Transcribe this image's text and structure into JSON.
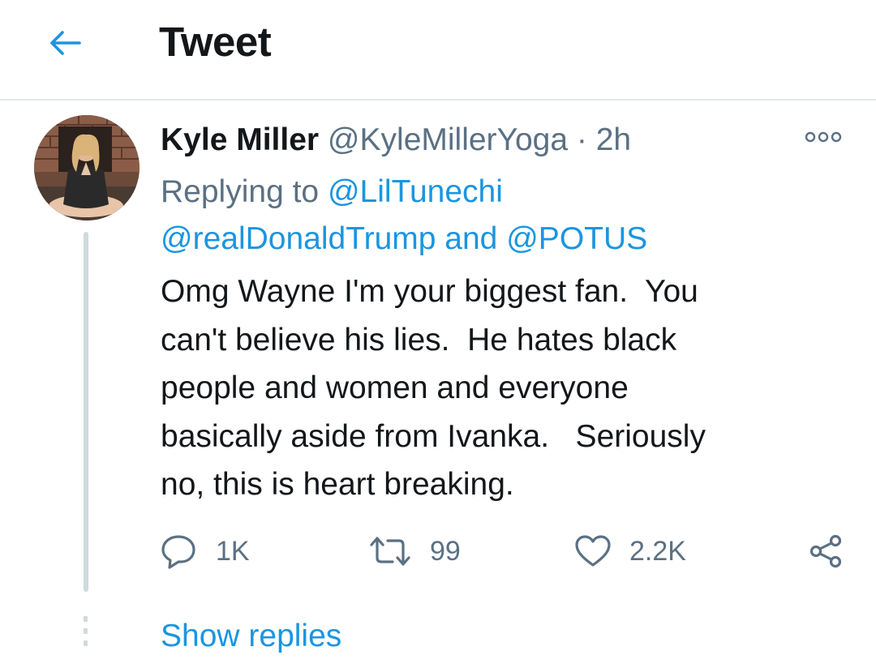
{
  "header": {
    "title": "Tweet",
    "back_icon": "arrow-left-icon"
  },
  "tweet": {
    "author": {
      "display_name": "Kyle Miller",
      "handle": "@KyleMillerYoga",
      "separator": "·",
      "time": "2h"
    },
    "replying_to": {
      "prefix": "Replying to",
      "mention_1": "@LilTunechi",
      "mention_2": "@realDonaldTrump",
      "conjunction": "and",
      "mention_3": "@POTUS"
    },
    "text": "Omg Wayne I'm your biggest fan.  You\ncan't believe his lies.  He hates black\npeople and women and everyone\nbasically aside from Ivanka.   Seriously\nno, this is heart breaking.",
    "actions": {
      "reply_count": "1K",
      "retweet_count": "99",
      "like_count": "2.2K"
    }
  },
  "show_replies_label": "Show replies",
  "colors": {
    "accent": "#1b95e0",
    "secondary_text": "#5b7083",
    "primary_text": "#14171a",
    "divider": "#e3e8ec"
  }
}
